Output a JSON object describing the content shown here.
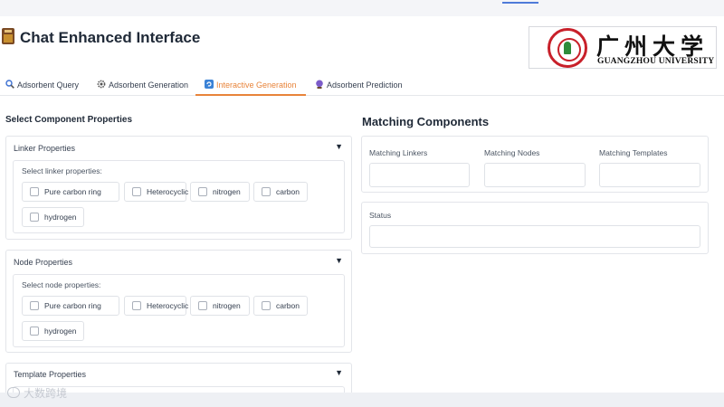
{
  "header": {
    "title": "Chat Enhanced Interface",
    "logo": {
      "cn_text": "广州大学",
      "en_text": "GUANGZHOU UNIVERSITY"
    }
  },
  "tabs": [
    {
      "label": "Adsorbent Query",
      "icon": "search-icon",
      "active": false
    },
    {
      "label": "Adsorbent Generation",
      "icon": "gear-icon",
      "active": false
    },
    {
      "label": "Interactive Generation",
      "icon": "refresh-icon",
      "active": true
    },
    {
      "label": "Adsorbent Prediction",
      "icon": "crystal-ball-icon",
      "active": false
    }
  ],
  "left": {
    "title": "Select Component Properties",
    "linker": {
      "header": "Linker Properties",
      "toggle": "▼",
      "group_label": "Select linker properties:",
      "options": [
        "Pure carbon ring",
        "Heterocyclic",
        "nitrogen",
        "carbon",
        "hydrogen"
      ]
    },
    "node": {
      "header": "Node Properties",
      "toggle": "▼",
      "group_label": "Select node properties:",
      "options": [
        "Pure carbon ring",
        "Heterocyclic",
        "nitrogen",
        "carbon",
        "hydrogen"
      ]
    },
    "template": {
      "header": "Template Properties",
      "toggle": "▼"
    }
  },
  "right": {
    "title": "Matching Components",
    "fields": {
      "linkers": {
        "label": "Matching Linkers",
        "value": ""
      },
      "nodes": {
        "label": "Matching Nodes",
        "value": ""
      },
      "templates": {
        "label": "Matching Templates",
        "value": ""
      },
      "status": {
        "label": "Status",
        "value": ""
      }
    }
  },
  "watermark": "大数跨境",
  "colors": {
    "accent": "#e8843a",
    "brand_red": "#c8202a",
    "border": "#e3e5ea"
  }
}
